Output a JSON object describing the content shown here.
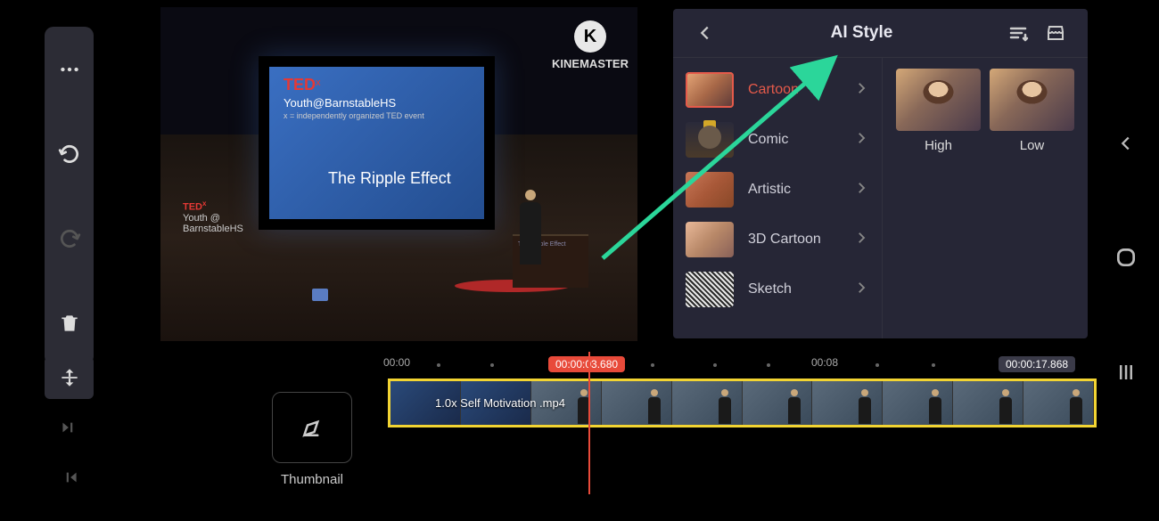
{
  "watermark": {
    "brand": "KINEMASTER",
    "logo_letter": "K"
  },
  "preview": {
    "slide_brand": "TED",
    "slide_x": "x",
    "slide_subtitle": "Youth@BarnstableHS",
    "slide_tagline": "x = independently organized TED event",
    "slide_title": "The Ripple Effect",
    "podium_text": "The Ripple Effect",
    "side_badge_brand": "TED",
    "side_badge_x": "x",
    "side_badge_line2": "Youth @",
    "side_badge_line3": "BarnstableHS"
  },
  "panel": {
    "title": "AI Style",
    "styles": [
      "Cartoon",
      "Comic",
      "Artistic",
      "3D Cartoon",
      "Sketch"
    ],
    "quality": {
      "high": "High",
      "low": "Low"
    }
  },
  "timeline": {
    "thumbnail_label": "Thumbnail",
    "ruler": {
      "start": "00:00",
      "mid": "00:08"
    },
    "current_time": "00:00:03.680",
    "end_time": "00:00:17.868",
    "clip_label": "1.0x Self Motivation .mp4"
  }
}
